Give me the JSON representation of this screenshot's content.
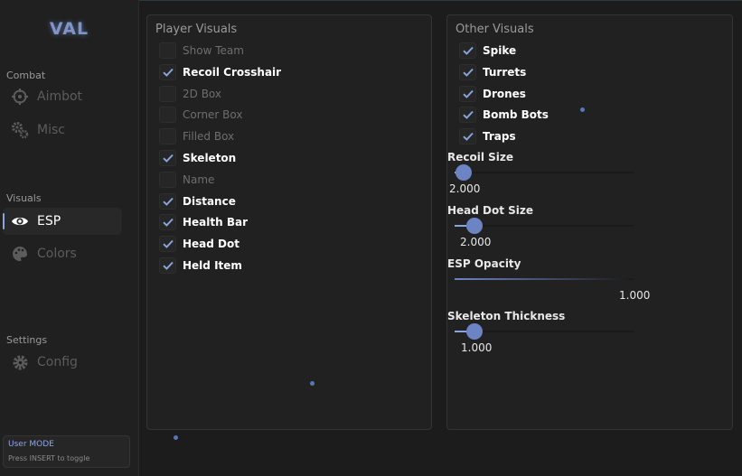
{
  "app": {
    "logo": "VAL"
  },
  "sidebar": {
    "sections": [
      {
        "label": "Combat",
        "items": [
          {
            "label": "Aimbot",
            "icon": "crosshair-icon",
            "active": false
          },
          {
            "label": "Misc",
            "icon": "gears-icon",
            "active": false
          }
        ]
      },
      {
        "label": "Visuals",
        "items": [
          {
            "label": "ESP",
            "icon": "eye-icon",
            "active": true
          },
          {
            "label": "Colors",
            "icon": "palette-icon",
            "active": false
          }
        ]
      },
      {
        "label": "Settings",
        "items": [
          {
            "label": "Config",
            "icon": "gear-icon",
            "active": false
          }
        ]
      }
    ],
    "mode": {
      "title": "User MODE",
      "hint": "Press INSERT to toggle"
    }
  },
  "player_visuals": {
    "title": "Player Visuals",
    "items": [
      {
        "label": "Show Team",
        "checked": false
      },
      {
        "label": "Recoil Crosshair",
        "checked": true
      },
      {
        "label": "2D Box",
        "checked": false
      },
      {
        "label": "Corner Box",
        "checked": false
      },
      {
        "label": "Filled Box",
        "checked": false
      },
      {
        "label": "Skeleton",
        "checked": true
      },
      {
        "label": "Name",
        "checked": false
      },
      {
        "label": "Distance",
        "checked": true
      },
      {
        "label": "Health Bar",
        "checked": true
      },
      {
        "label": "Head Dot",
        "checked": true
      },
      {
        "label": "Held Item",
        "checked": true
      }
    ]
  },
  "other_visuals": {
    "title": "Other Visuals",
    "items": [
      {
        "label": "Spike",
        "checked": true
      },
      {
        "label": "Turrets",
        "checked": true
      },
      {
        "label": "Drones",
        "checked": true
      },
      {
        "label": "Bomb Bots",
        "checked": true
      },
      {
        "label": "Traps",
        "checked": true
      }
    ],
    "sliders": [
      {
        "label": "Recoil Size",
        "value": "2.000",
        "fraction": 0.05
      },
      {
        "label": "Head Dot Size",
        "value": "2.000",
        "fraction": 0.11
      },
      {
        "label": "ESP Opacity",
        "value": "1.000",
        "fraction": 1.0
      },
      {
        "label": "Skeleton Thickness",
        "value": "1.000",
        "fraction": 0.11
      }
    ]
  },
  "colors": {
    "accent": "#8aa4e0",
    "knob": "#6c84c4",
    "checkmark": "#8aa4e0"
  }
}
